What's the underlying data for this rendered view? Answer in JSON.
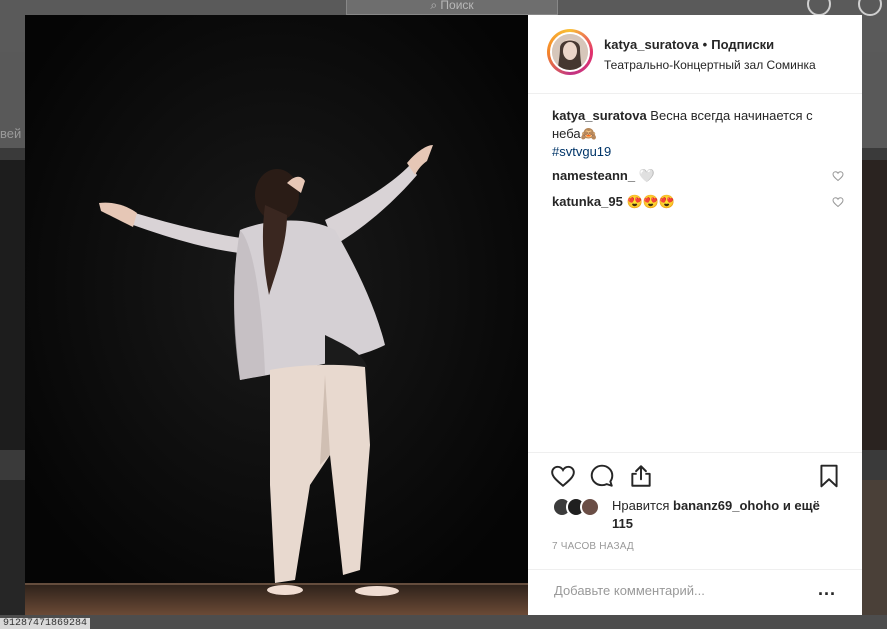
{
  "background": {
    "search_placeholder": "Поиск",
    "side_text": "вей",
    "status_url": "91287471869284"
  },
  "post": {
    "username": "katya_suratova",
    "separator": "•",
    "follow_label": "Подписки",
    "location": "Театрально-Концертный зал Соминка",
    "caption": {
      "username": "katya_suratova",
      "text": "Весна всегда начинается с неба🙈",
      "hashtag": "#svtvgu19"
    },
    "comments": [
      {
        "username": "namesteann_",
        "text": "🤍"
      },
      {
        "username": "katunka_95",
        "text": "😍😍😍"
      }
    ],
    "likes": {
      "prefix": "Нравится",
      "user": "bananz69_ohoho",
      "suffix": "и ещё 115"
    },
    "time": "7 ЧАСОВ НАЗАД",
    "comment_placeholder": "Добавьте комментарий...",
    "more_label": "..."
  },
  "colors": {
    "hashtag": "#003569",
    "text": "#262626",
    "muted": "#999999"
  },
  "icons": [
    "heart-icon",
    "comment-icon",
    "share-icon",
    "bookmark-icon",
    "small-heart-icon",
    "more-icon"
  ]
}
